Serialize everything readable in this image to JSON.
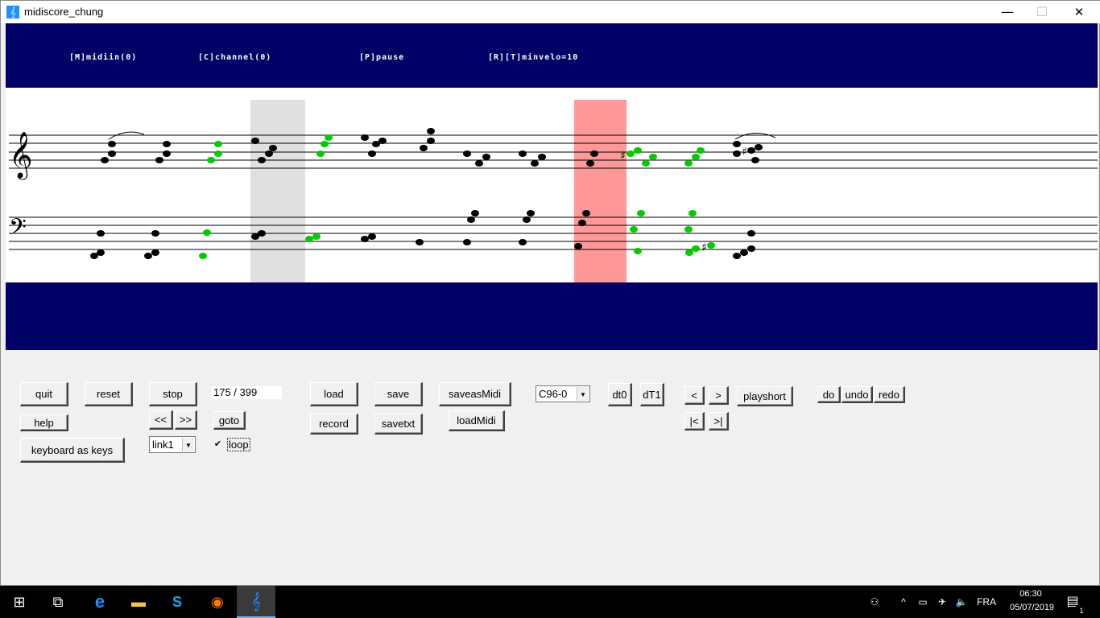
{
  "window": {
    "title": "midiscore_chung",
    "minimize_glyph": "—",
    "maximize_glyph": "☐",
    "close_glyph": "✕",
    "app_icon_glyph": "𝄞"
  },
  "score_header": {
    "labels": [
      "[M]midiin(0)",
      "[C]channel(0)",
      "[P]pause",
      "[R][T]minvelo=10"
    ]
  },
  "colors": {
    "score_bg": "#000066",
    "staff_bg": "#ffffff",
    "note_black": "#000000",
    "note_green": "#00cc00",
    "grey_marker": "#e0e0e0",
    "red_marker": "#ff9999"
  },
  "score": {
    "treble_clef": "𝄞",
    "bass_clef": "𝄢",
    "sharp": "♯"
  },
  "controls": {
    "quit": "quit",
    "reset": "reset",
    "stop": "stop",
    "position": "175 / 399",
    "load": "load",
    "save": "save",
    "saveasMidi": "saveasMidi",
    "instrument": "C96-0",
    "dt0": "dt0",
    "dT1": "dT1",
    "prev": "<",
    "next": ">",
    "playshort": "playshort",
    "do": "do",
    "undo": "undo",
    "redo": "redo",
    "help": "help",
    "rewind": "<<",
    "forward": ">>",
    "goto": "goto",
    "record": "record",
    "savetxt": "savetxt",
    "loadMidi": "loadMidi",
    "first": "|<",
    "last": ">|",
    "keyboard": "keyboard as keys",
    "link": "link1",
    "loop_checked": "✔",
    "loop": "loop"
  },
  "taskbar": {
    "language": "FRA",
    "time": "06:30",
    "date": "05/07/2019",
    "notifications": "1",
    "start_glyph": "⊞",
    "task_view_glyph": "⧉",
    "edge_glyph": "e",
    "explorer_glyph": "▬",
    "skype_glyph": "S",
    "firefox_glyph": "◉",
    "midiscore_glyph": "𝄞",
    "people_glyph": "⚇",
    "chevron_glyph": "^",
    "battery_glyph": "▭",
    "network_glyph": "✈",
    "volume_glyph": "🔈",
    "notif_glyph": "▤"
  }
}
